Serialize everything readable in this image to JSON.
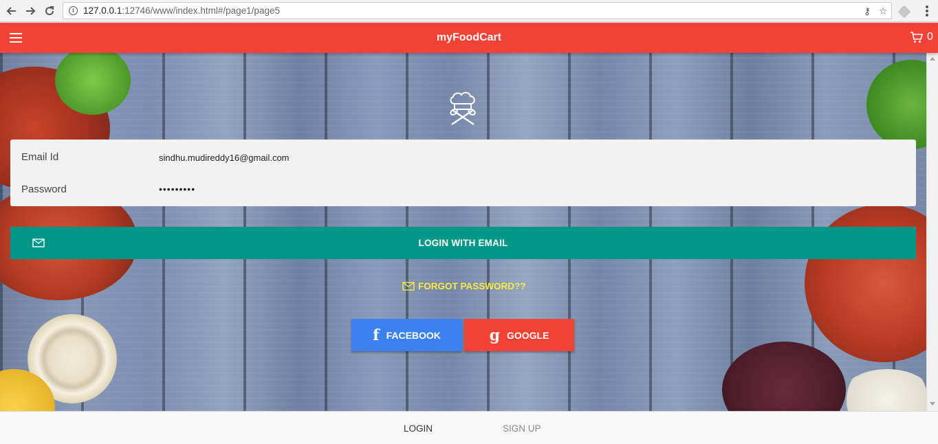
{
  "browser": {
    "url_host": "127.0.0.1",
    "url_rest": ":12746/www/index.html#/page1/page5"
  },
  "header": {
    "title": "myFoodCart",
    "cart_count": "0"
  },
  "form": {
    "email_label": "Email Id",
    "email_value": "sindhu.mudireddy16@gmail.com",
    "password_label": "Password",
    "password_value": "•••••••••"
  },
  "actions": {
    "login_email": "LOGIN WITH EMAIL",
    "forgot_password": "FORGOT PASSWORD??",
    "facebook": "FACEBOOK",
    "google": "GOOGLE"
  },
  "tabs": {
    "login": "LOGIN",
    "signup": "SIGN UP"
  },
  "icons": {
    "menu": "hamburger-icon",
    "cart": "cart-icon",
    "logo": "chef-hat-icon",
    "mail": "envelope-icon",
    "facebook": "facebook-icon",
    "google": "google-icon"
  },
  "colors": {
    "header": "#f44336",
    "email_button": "#009688",
    "facebook": "#3b82f0",
    "google": "#f44336",
    "forgot_text": "#ffeb3b"
  }
}
